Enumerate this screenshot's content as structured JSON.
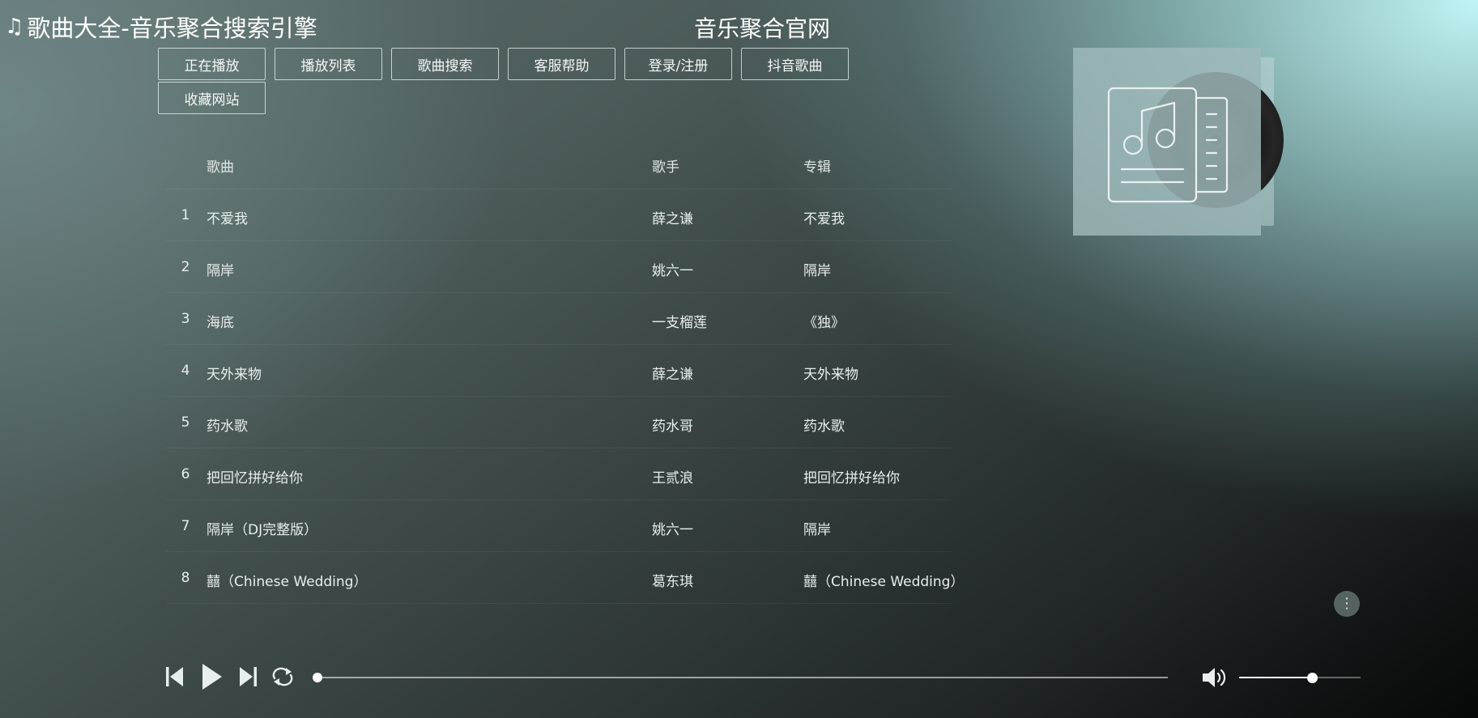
{
  "header": {
    "site_title": "歌曲大全-音乐聚合搜索引擎",
    "center_title": "音乐聚合官网"
  },
  "nav": [
    {
      "label": "正在播放"
    },
    {
      "label": "播放列表"
    },
    {
      "label": "歌曲搜索"
    },
    {
      "label": "客服帮助"
    },
    {
      "label": "登录/注册"
    },
    {
      "label": "抖音歌曲"
    },
    {
      "label": "收藏网站"
    }
  ],
  "table": {
    "columns": {
      "song": "歌曲",
      "singer": "歌手",
      "album": "专辑"
    },
    "rows": [
      {
        "num": "1",
        "song": "不爱我",
        "singer": "薛之谦",
        "album": "不爱我"
      },
      {
        "num": "2",
        "song": "隔岸",
        "singer": "姚六一",
        "album": "隔岸"
      },
      {
        "num": "3",
        "song": "海底",
        "singer": "一支榴莲",
        "album": "《独》"
      },
      {
        "num": "4",
        "song": "天外来物",
        "singer": "薛之谦",
        "album": "天外来物"
      },
      {
        "num": "5",
        "song": "药水歌",
        "singer": "药水哥",
        "album": "药水歌"
      },
      {
        "num": "6",
        "song": "把回忆拼好给你",
        "singer": "王贰浪",
        "album": "把回忆拼好给你"
      },
      {
        "num": "7",
        "song": "隔岸（DJ完整版）",
        "singer": "姚六一",
        "album": "隔岸"
      },
      {
        "num": "8",
        "song": "囍（Chinese Wedding）",
        "singer": "葛东琪",
        "album": "囍（Chinese Wedding）"
      }
    ]
  },
  "player": {
    "progress": 0,
    "volume": 0.6
  },
  "icons": {
    "title": "music-note-icon",
    "cover": "music-document-icon",
    "more": "more-vertical-icon",
    "prev": "skip-back-icon",
    "play": "play-icon",
    "next": "skip-forward-icon",
    "loop": "repeat-icon",
    "volume": "volume-icon"
  }
}
